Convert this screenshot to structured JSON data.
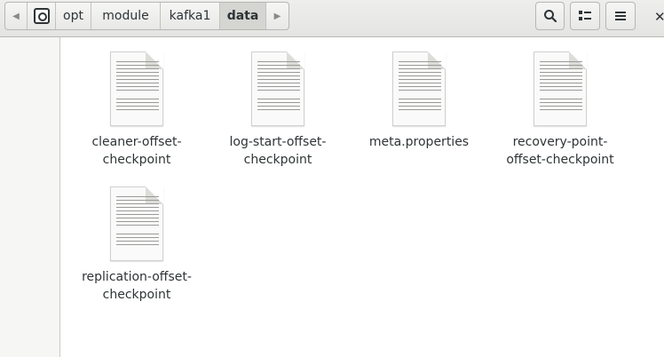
{
  "breadcrumb": {
    "segments": [
      "opt",
      "module",
      "kafka1",
      "data"
    ],
    "current": "data"
  },
  "icons": {
    "back": "chevron-left-icon",
    "forward": "chevron-right-icon",
    "home": "home-folder-icon",
    "search": "search-icon",
    "view": "view-options-icon",
    "menu": "hamburger-menu-icon",
    "close": "close-icon"
  },
  "files": [
    {
      "line1": "cleaner-offset-",
      "line2": "checkpoint"
    },
    {
      "line1": "log-start-offset-",
      "line2": "checkpoint"
    },
    {
      "line1": "meta.properties",
      "line2": ""
    },
    {
      "line1": "recovery-point-",
      "line2": "offset-checkpoint"
    },
    {
      "line1": "replication-offset-",
      "line2": "checkpoint"
    }
  ]
}
